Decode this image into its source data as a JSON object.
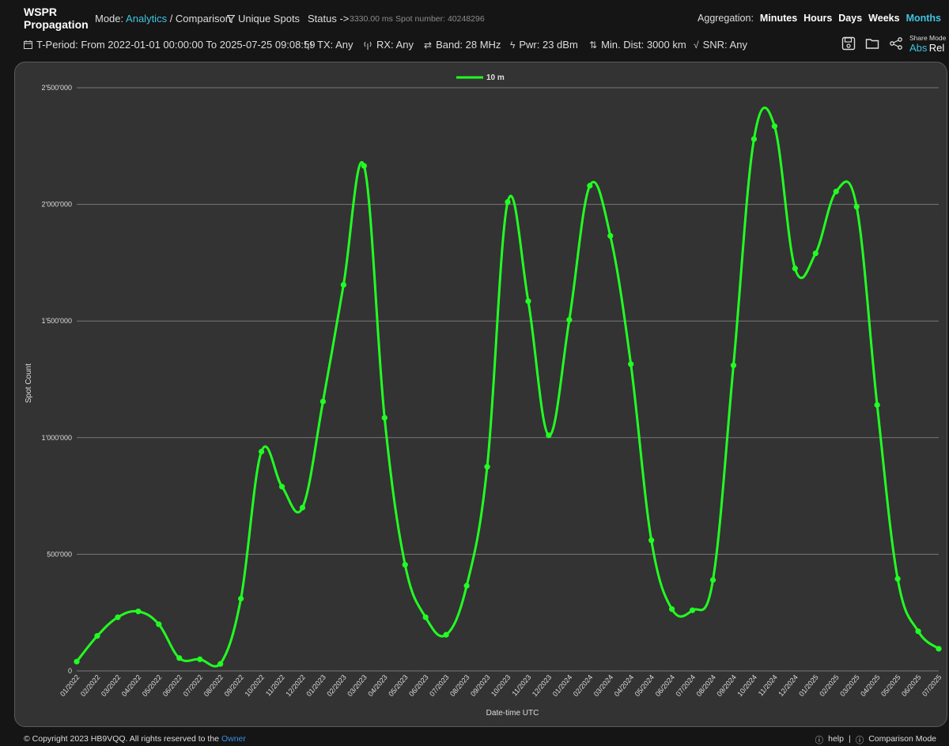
{
  "header": {
    "brand_line1": "WSPR",
    "brand_line2": "Propagation",
    "mode_label": "Mode:",
    "mode_analytics": "Analytics",
    "mode_separator": " / ",
    "mode_comparison": "Comparison",
    "unique_spots": "Unique Spots",
    "status_label": "Status ->",
    "status_ms": "3330.00 ms",
    "spot_number": "Spot number: 40248296",
    "aggregation_label": "Aggregation:",
    "aggregation_options": [
      "Minutes",
      "Hours",
      "Days",
      "Weeks",
      "Months"
    ],
    "aggregation_active": "Months"
  },
  "filters": {
    "period": "T-Period: From 2022-01-01 00:00:00 To 2025-07-25 09:08:59",
    "tx": "TX: Any",
    "rx": "RX: Any",
    "band": "Band: 28 MHz",
    "pwr": "Pwr: 23 dBm",
    "min_dist": "Min. Dist: 3000 km",
    "snr": "SNR: Any"
  },
  "share": {
    "label": "Share Mode",
    "abs": "Abs",
    "rel": "Rel"
  },
  "icons": {
    "save": "save-icon",
    "folder": "folder-icon",
    "share": "share-icon"
  },
  "colors": {
    "series": "#22ff22",
    "accent": "#3fc3e0",
    "panel": "#333333"
  },
  "chart_data": {
    "type": "line",
    "xlabel": "Date-time UTC",
    "ylabel": "Spot Count",
    "legend_position": "top-center",
    "grid": true,
    "ylim": [
      0,
      2500000
    ],
    "y_ticks": [
      "0",
      "500'000",
      "1'000'000",
      "1'500'000",
      "2'000'000",
      "2'500'000"
    ],
    "y_tick_values": [
      0,
      500000,
      1000000,
      1500000,
      2000000,
      2500000
    ],
    "categories": [
      "01/2022",
      "02/2022",
      "03/2022",
      "04/2022",
      "05/2022",
      "06/2022",
      "07/2022",
      "08/2022",
      "09/2022",
      "10/2022",
      "11/2022",
      "12/2022",
      "01/2023",
      "02/2023",
      "03/2023",
      "04/2023",
      "05/2023",
      "06/2023",
      "07/2023",
      "08/2023",
      "09/2023",
      "10/2023",
      "11/2023",
      "12/2023",
      "01/2024",
      "02/2024",
      "03/2024",
      "04/2024",
      "05/2024",
      "06/2024",
      "07/2024",
      "08/2024",
      "09/2024",
      "10/2024",
      "11/2024",
      "12/2024",
      "01/2025",
      "02/2025",
      "03/2025",
      "04/2025",
      "05/2025",
      "06/2025",
      "07/2025"
    ],
    "series": [
      {
        "name": "10 m",
        "values": [
          40000,
          150000,
          230000,
          255000,
          200000,
          55000,
          50000,
          30000,
          310000,
          940000,
          790000,
          700000,
          1155000,
          1655000,
          2165000,
          1085000,
          455000,
          230000,
          155000,
          365000,
          875000,
          2010000,
          1585000,
          1010000,
          1505000,
          2080000,
          1865000,
          1315000,
          560000,
          265000,
          260000,
          390000,
          1310000,
          2280000,
          2335000,
          1725000,
          1790000,
          2055000,
          1990000,
          1140000,
          395000,
          170000,
          95000
        ]
      }
    ]
  },
  "footer": {
    "copyright": "© Copyright 2023 HB9VQQ. All rights reserved to the ",
    "owner": "Owner",
    "help": "help",
    "separator": "|",
    "comparison_mode": "Comparison Mode"
  }
}
